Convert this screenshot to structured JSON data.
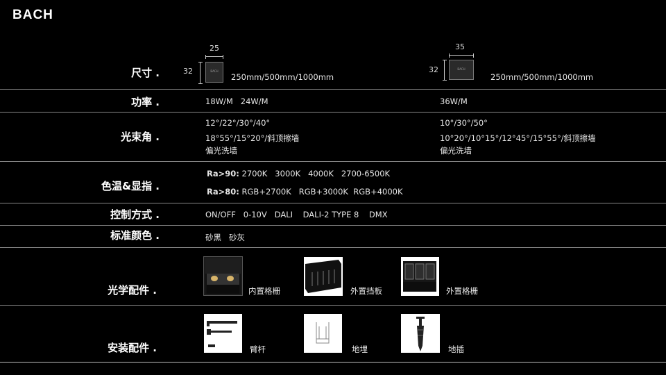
{
  "brand": "BACH",
  "rows": {
    "size": {
      "label": "尺寸 .",
      "a": {
        "width": "25",
        "height": "32",
        "lengths": "250mm/500mm/1000mm",
        "profile_text": "BACH"
      },
      "b": {
        "width": "35",
        "height": "32",
        "lengths": "250mm/500mm/1000mm",
        "profile_text": "BACH"
      }
    },
    "power": {
      "label": "功率 .",
      "a": "18W/M   24W/M",
      "b": "36W/M"
    },
    "beam": {
      "label": "光束角 .",
      "a": [
        "12°/22°/30°/40°",
        "18°55°/15°20°/斜顶擦墙",
        "偏光洗墙"
      ],
      "b": [
        "10°/30°/50°",
        "10°20°/10°15°/12°45°/15°55°/斜顶擦墙",
        "偏光洗墙"
      ]
    },
    "cct": {
      "label": "色温&显指 .",
      "line1_prefix": "Ra",
      "line1_cond": ">90:",
      "line1_values": "2700K   3000K   4000K   2700-6500K",
      "line2_prefix": "Ra",
      "line2_cond": ">80:",
      "line2_values": "RGB+2700K   RGB+3000K  RGB+4000K"
    },
    "control": {
      "label": "控制方式 .",
      "value": "ON/OFF   0-10V   DALI    DALI-2 TYPE 8    DMX"
    },
    "color": {
      "label": "标准颜色 .",
      "value": "砂黑   砂灰"
    },
    "optics": {
      "label": "光学配件 .",
      "items": [
        {
          "caption": "内置格栅",
          "icon": "inner-grille-icon"
        },
        {
          "caption": "外置挡板",
          "icon": "outer-baffle-icon"
        },
        {
          "caption": "外置格栅",
          "icon": "outer-grille-icon"
        }
      ]
    },
    "mounting": {
      "label": "安装配件 .",
      "items": [
        {
          "caption": "臂杆",
          "icon": "arm-rod-icon"
        },
        {
          "caption": "地埋",
          "icon": "ground-buried-icon"
        },
        {
          "caption": "地插",
          "icon": "ground-spike-icon"
        }
      ]
    }
  }
}
